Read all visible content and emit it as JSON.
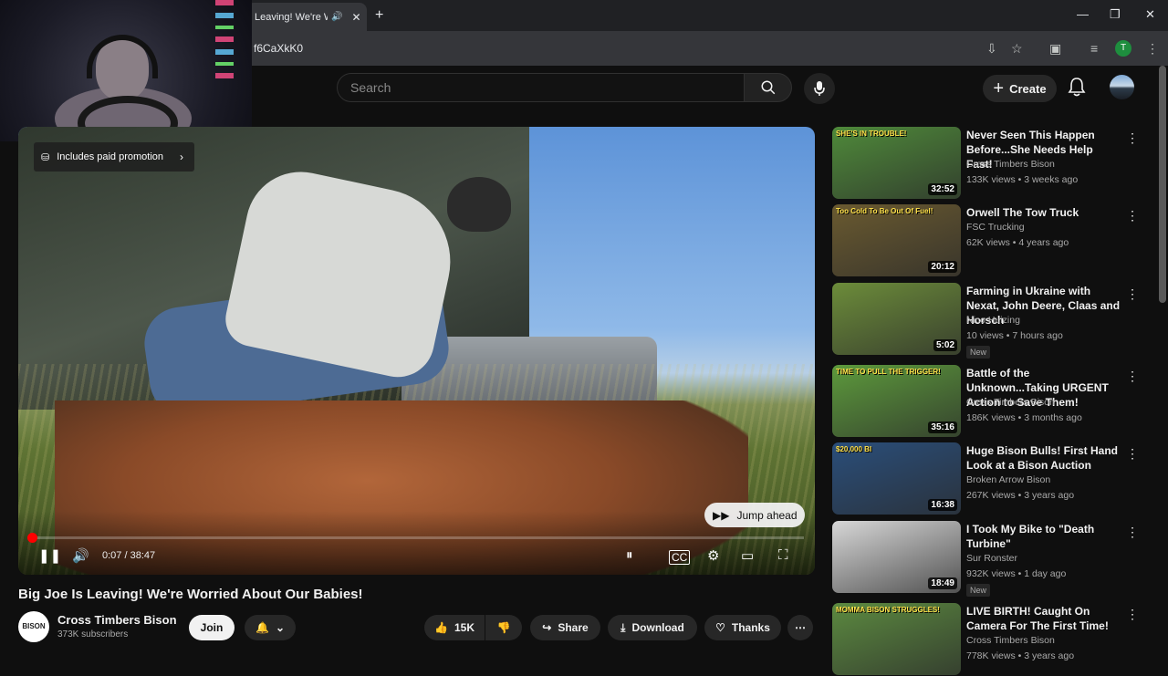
{
  "browser": {
    "tab_title": "Leaving! We're W",
    "new_tab": "+",
    "url_fragment": "f6CaXkK0",
    "profile_initial": "T",
    "win_min": "—",
    "win_max": "❐",
    "win_close": "✕"
  },
  "header": {
    "search_placeholder": "Search",
    "create_label": "Create"
  },
  "player": {
    "promo_label": "Includes paid promotion",
    "jump_label": "Jump ahead",
    "time": "0:07 / 38:47",
    "progress": 0.003
  },
  "video": {
    "title": "Big Joe Is Leaving! We're Worried About Our Babies!",
    "channel_name": "Cross Timbers Bison",
    "subscribers": "373K subscribers",
    "channel_badge": "BISON",
    "join_label": "Join",
    "likes": "15K",
    "share_label": "Share",
    "download_label": "Download",
    "thanks_label": "Thanks"
  },
  "sidebar": {
    "items": [
      {
        "title": "Never Seen This Happen Before...She Needs Help Fast!",
        "channel": "Cross Timbers Bison",
        "meta": "133K views • 3 weeks ago",
        "duration": "32:52",
        "thumb_text": "SHE'S IN TROUBLE!",
        "badge": "",
        "thumb_color": "#4f8a3a"
      },
      {
        "title": "Orwell The Tow Truck",
        "channel": "FSC Trucking",
        "meta": "62K views • 4 years ago",
        "duration": "20:12",
        "thumb_text": "Too Cold To Be Out Of Fuel!",
        "badge": "",
        "thumb_color": "#6a5a30"
      },
      {
        "title": "Farming in Ukraine with Nexat, John Deere, Claas and Horsch",
        "channel": "Nico Huizing",
        "meta": "10 views • 7 hours ago",
        "duration": "5:02",
        "thumb_text": "",
        "badge": "New",
        "thumb_color": "#6c8c3a"
      },
      {
        "title": "Battle of the Unknown...Taking URGENT Action to Save Them!",
        "channel": "Cross Timbers Bison",
        "meta": "186K views • 3 months ago",
        "duration": "35:16",
        "thumb_text": "TIME TO PULL THE TRIGGER!",
        "badge": "",
        "thumb_color": "#5d9a3c"
      },
      {
        "title": "Huge Bison Bulls! First Hand Look at a Bison Auction",
        "channel": "Broken Arrow Bison",
        "meta": "267K views • 3 years ago",
        "duration": "16:38",
        "thumb_text": "$20,000 BI",
        "badge": "",
        "thumb_color": "#2a4e7a"
      },
      {
        "title": "I Took My Bike to \"Death Turbine\"",
        "channel": "Sur Ronster",
        "meta": "932K views • 1 day ago",
        "duration": "18:49",
        "thumb_text": "",
        "badge": "New",
        "thumb_color": "#d7d7d7"
      },
      {
        "title": "LIVE BIRTH! Caught On Camera For The First Time!",
        "channel": "Cross Timbers Bison",
        "meta": "778K views • 3 years ago",
        "duration": "",
        "thumb_text": "MOMMA BISON STRUGGLES!",
        "badge": "",
        "thumb_color": "#5c8a40"
      }
    ]
  }
}
